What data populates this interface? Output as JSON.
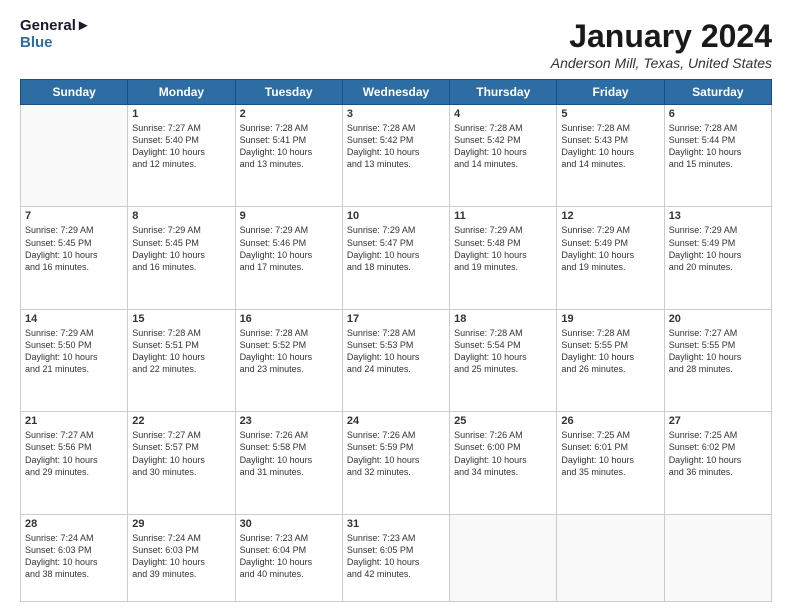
{
  "logo": {
    "line1": "General",
    "line2": "Blue"
  },
  "title": "January 2024",
  "location": "Anderson Mill, Texas, United States",
  "headers": [
    "Sunday",
    "Monday",
    "Tuesday",
    "Wednesday",
    "Thursday",
    "Friday",
    "Saturday"
  ],
  "weeks": [
    [
      {
        "day": "",
        "content": ""
      },
      {
        "day": "1",
        "content": "Sunrise: 7:27 AM\nSunset: 5:40 PM\nDaylight: 10 hours\nand 12 minutes."
      },
      {
        "day": "2",
        "content": "Sunrise: 7:28 AM\nSunset: 5:41 PM\nDaylight: 10 hours\nand 13 minutes."
      },
      {
        "day": "3",
        "content": "Sunrise: 7:28 AM\nSunset: 5:42 PM\nDaylight: 10 hours\nand 13 minutes."
      },
      {
        "day": "4",
        "content": "Sunrise: 7:28 AM\nSunset: 5:42 PM\nDaylight: 10 hours\nand 14 minutes."
      },
      {
        "day": "5",
        "content": "Sunrise: 7:28 AM\nSunset: 5:43 PM\nDaylight: 10 hours\nand 14 minutes."
      },
      {
        "day": "6",
        "content": "Sunrise: 7:28 AM\nSunset: 5:44 PM\nDaylight: 10 hours\nand 15 minutes."
      }
    ],
    [
      {
        "day": "7",
        "content": "Sunrise: 7:29 AM\nSunset: 5:45 PM\nDaylight: 10 hours\nand 16 minutes."
      },
      {
        "day": "8",
        "content": "Sunrise: 7:29 AM\nSunset: 5:45 PM\nDaylight: 10 hours\nand 16 minutes."
      },
      {
        "day": "9",
        "content": "Sunrise: 7:29 AM\nSunset: 5:46 PM\nDaylight: 10 hours\nand 17 minutes."
      },
      {
        "day": "10",
        "content": "Sunrise: 7:29 AM\nSunset: 5:47 PM\nDaylight: 10 hours\nand 18 minutes."
      },
      {
        "day": "11",
        "content": "Sunrise: 7:29 AM\nSunset: 5:48 PM\nDaylight: 10 hours\nand 19 minutes."
      },
      {
        "day": "12",
        "content": "Sunrise: 7:29 AM\nSunset: 5:49 PM\nDaylight: 10 hours\nand 19 minutes."
      },
      {
        "day": "13",
        "content": "Sunrise: 7:29 AM\nSunset: 5:49 PM\nDaylight: 10 hours\nand 20 minutes."
      }
    ],
    [
      {
        "day": "14",
        "content": "Sunrise: 7:29 AM\nSunset: 5:50 PM\nDaylight: 10 hours\nand 21 minutes."
      },
      {
        "day": "15",
        "content": "Sunrise: 7:28 AM\nSunset: 5:51 PM\nDaylight: 10 hours\nand 22 minutes."
      },
      {
        "day": "16",
        "content": "Sunrise: 7:28 AM\nSunset: 5:52 PM\nDaylight: 10 hours\nand 23 minutes."
      },
      {
        "day": "17",
        "content": "Sunrise: 7:28 AM\nSunset: 5:53 PM\nDaylight: 10 hours\nand 24 minutes."
      },
      {
        "day": "18",
        "content": "Sunrise: 7:28 AM\nSunset: 5:54 PM\nDaylight: 10 hours\nand 25 minutes."
      },
      {
        "day": "19",
        "content": "Sunrise: 7:28 AM\nSunset: 5:55 PM\nDaylight: 10 hours\nand 26 minutes."
      },
      {
        "day": "20",
        "content": "Sunrise: 7:27 AM\nSunset: 5:55 PM\nDaylight: 10 hours\nand 28 minutes."
      }
    ],
    [
      {
        "day": "21",
        "content": "Sunrise: 7:27 AM\nSunset: 5:56 PM\nDaylight: 10 hours\nand 29 minutes."
      },
      {
        "day": "22",
        "content": "Sunrise: 7:27 AM\nSunset: 5:57 PM\nDaylight: 10 hours\nand 30 minutes."
      },
      {
        "day": "23",
        "content": "Sunrise: 7:26 AM\nSunset: 5:58 PM\nDaylight: 10 hours\nand 31 minutes."
      },
      {
        "day": "24",
        "content": "Sunrise: 7:26 AM\nSunset: 5:59 PM\nDaylight: 10 hours\nand 32 minutes."
      },
      {
        "day": "25",
        "content": "Sunrise: 7:26 AM\nSunset: 6:00 PM\nDaylight: 10 hours\nand 34 minutes."
      },
      {
        "day": "26",
        "content": "Sunrise: 7:25 AM\nSunset: 6:01 PM\nDaylight: 10 hours\nand 35 minutes."
      },
      {
        "day": "27",
        "content": "Sunrise: 7:25 AM\nSunset: 6:02 PM\nDaylight: 10 hours\nand 36 minutes."
      }
    ],
    [
      {
        "day": "28",
        "content": "Sunrise: 7:24 AM\nSunset: 6:03 PM\nDaylight: 10 hours\nand 38 minutes."
      },
      {
        "day": "29",
        "content": "Sunrise: 7:24 AM\nSunset: 6:03 PM\nDaylight: 10 hours\nand 39 minutes."
      },
      {
        "day": "30",
        "content": "Sunrise: 7:23 AM\nSunset: 6:04 PM\nDaylight: 10 hours\nand 40 minutes."
      },
      {
        "day": "31",
        "content": "Sunrise: 7:23 AM\nSunset: 6:05 PM\nDaylight: 10 hours\nand 42 minutes."
      },
      {
        "day": "",
        "content": ""
      },
      {
        "day": "",
        "content": ""
      },
      {
        "day": "",
        "content": ""
      }
    ]
  ]
}
